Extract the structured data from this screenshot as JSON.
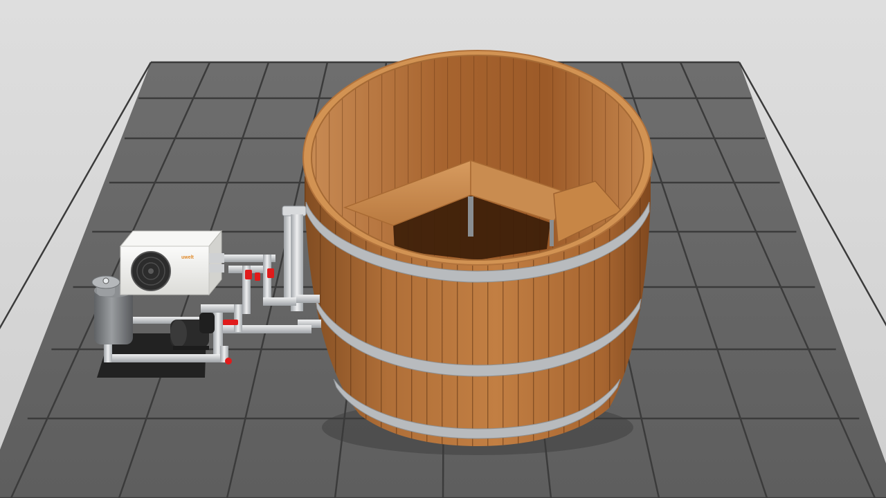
{
  "scene": {
    "subject": "wooden-hot-tub-with-heat-pump",
    "colors": {
      "background": "#d7d7d7",
      "floor_tile": "#6f6f6f",
      "grout": "#3d3d3d",
      "wood_light": "#c98a4e",
      "wood_dark": "#8a4f22",
      "rim": "#d39456",
      "band": "#b9bcbf",
      "pipe": "#d7d9db",
      "valve": "#e01b1b",
      "heat_pump_body": "#f1f1ef",
      "pump_motor": "#2a2a2a",
      "filter": "#7d7f82",
      "mat": "#222222"
    },
    "heat_pump": {
      "logo": "uwelt"
    },
    "valve_count": 4
  }
}
